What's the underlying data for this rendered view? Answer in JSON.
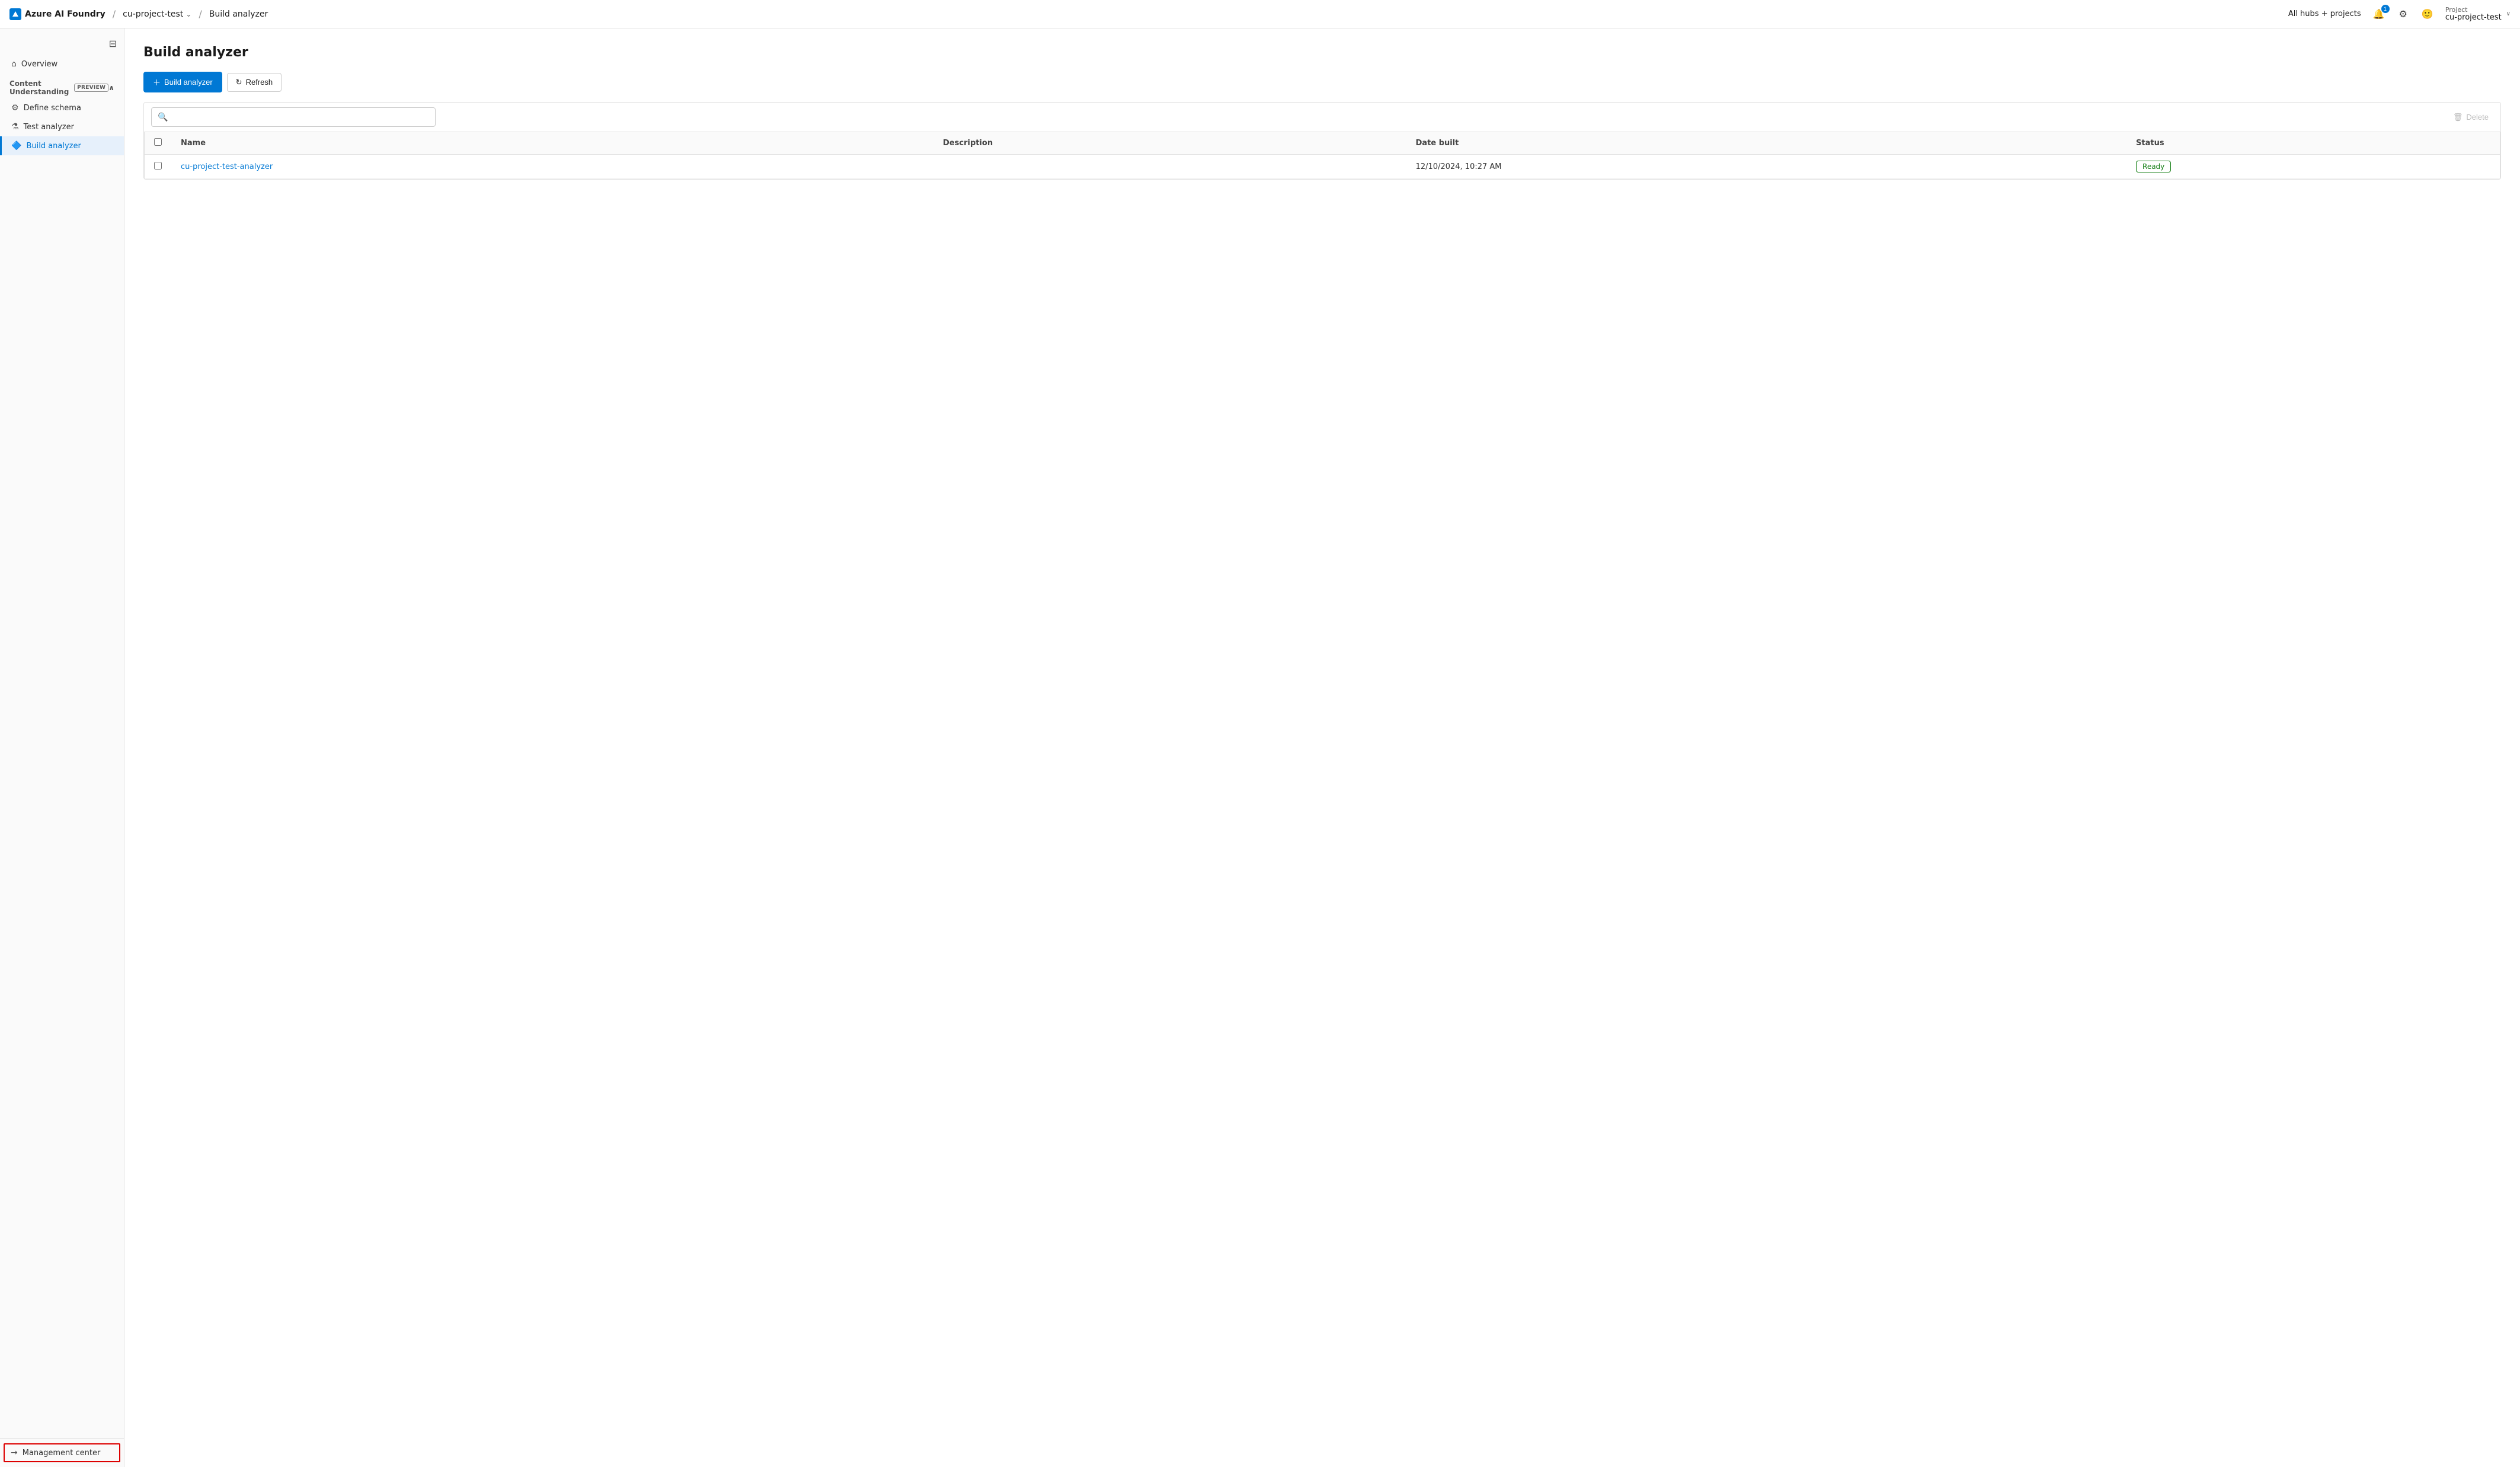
{
  "header": {
    "brand": "Azure AI Foundry",
    "project": "cu-project-test",
    "breadcrumb_sep": "/",
    "current_page": "Build analyzer",
    "all_hubs": "All hubs + projects",
    "notification_count": "1",
    "project_label": "Project",
    "project_name": "cu-project-test",
    "chevron": "∨"
  },
  "sidebar": {
    "toggle_icon": "⊟",
    "overview_label": "Overview",
    "section_label": "Content Understanding",
    "preview_badge": "PREVIEW",
    "section_chevron": "∧",
    "items": [
      {
        "id": "define-schema",
        "label": "Define schema",
        "icon": "⚙"
      },
      {
        "id": "test-analyzer",
        "label": "Test analyzer",
        "icon": "⚗"
      },
      {
        "id": "build-analyzer",
        "label": "Build analyzer",
        "icon": "🔷"
      }
    ],
    "bottom": {
      "label": "Management center",
      "icon": "→"
    }
  },
  "main": {
    "page_title": "Build analyzer",
    "toolbar": {
      "build_btn": "Build analyzer",
      "refresh_btn": "Refresh"
    },
    "search_placeholder": "",
    "delete_btn": "Delete",
    "table": {
      "columns": [
        "Name",
        "Description",
        "Date built",
        "Status"
      ],
      "rows": [
        {
          "name": "cu-project-test-analyzer",
          "description": "",
          "date_built": "12/10/2024, 10:27 AM",
          "status": "Ready"
        }
      ]
    }
  }
}
